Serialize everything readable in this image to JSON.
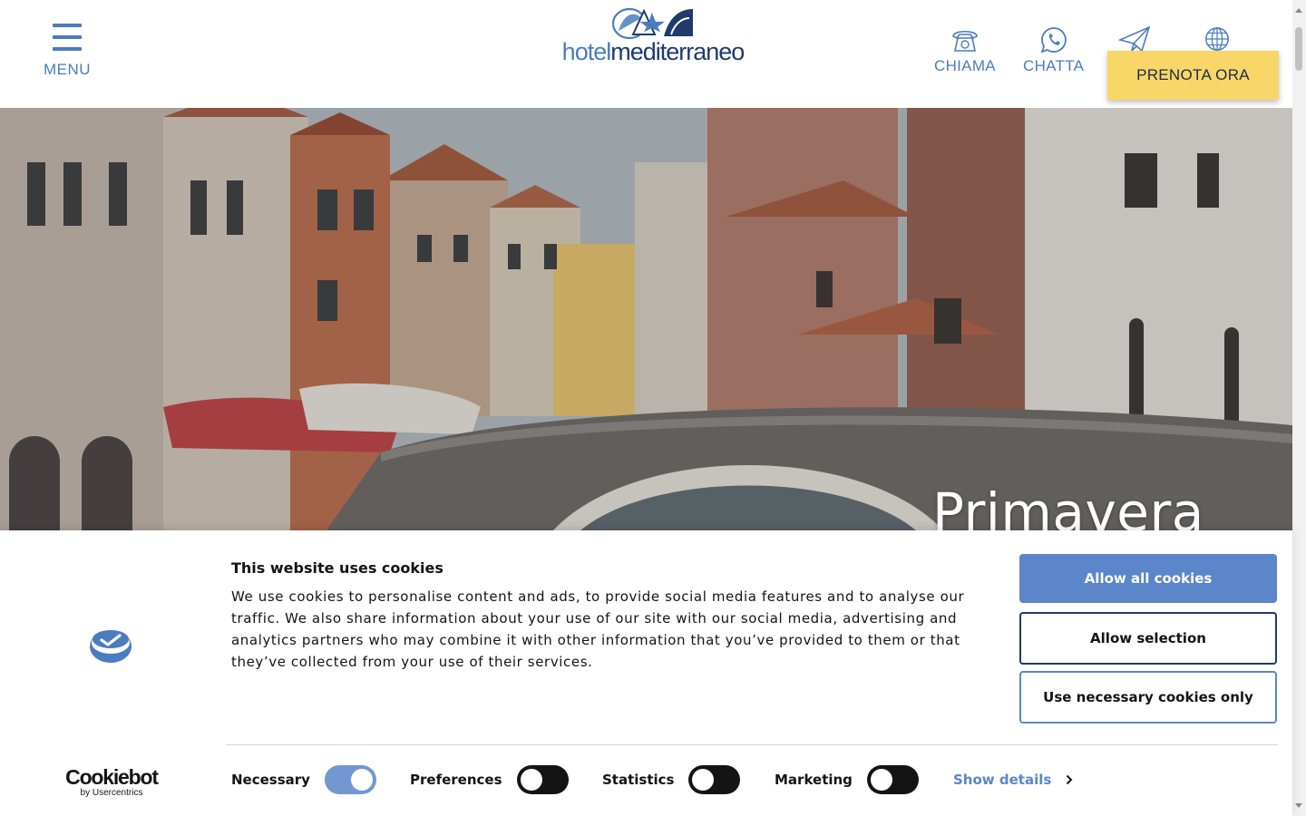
{
  "header": {
    "menu_label": "MENU",
    "logo_left": "hotel",
    "logo_right": "mediterraneo",
    "actions": [
      {
        "label": "CHIAMA",
        "icon": "phone-icon"
      },
      {
        "label": "CHATTA",
        "icon": "whatsapp-icon"
      },
      {
        "label": "",
        "icon": "paper-plane-icon"
      },
      {
        "label": "",
        "icon": "globe-icon"
      }
    ],
    "book_label": "PRENOTA ORA",
    "accent_color": "#4a7cc0",
    "book_color": "#f8d668"
  },
  "hero": {
    "title": "Primavera"
  },
  "cookie_banner": {
    "title": "This website uses cookies",
    "text": "We use cookies to personalise content and ads, to provide social media features and to analyse our traffic. We also share information about your use of our site with our social media, advertising and analytics partners who may combine it with other information that you’ve provided to them or that they’ve collected from your use of their services.",
    "buttons": {
      "allow_all": "Allow all cookies",
      "allow_selection": "Allow selection",
      "necessary_only": "Use necessary cookies only"
    },
    "toggles": [
      {
        "label": "Necessary",
        "on": true
      },
      {
        "label": "Preferences",
        "on": false
      },
      {
        "label": "Statistics",
        "on": false
      },
      {
        "label": "Marketing",
        "on": false
      }
    ],
    "show_details": "Show details",
    "brand_name": "Cookiebot",
    "brand_sub": "by Usercentrics",
    "accent_color": "#5b86c9"
  }
}
